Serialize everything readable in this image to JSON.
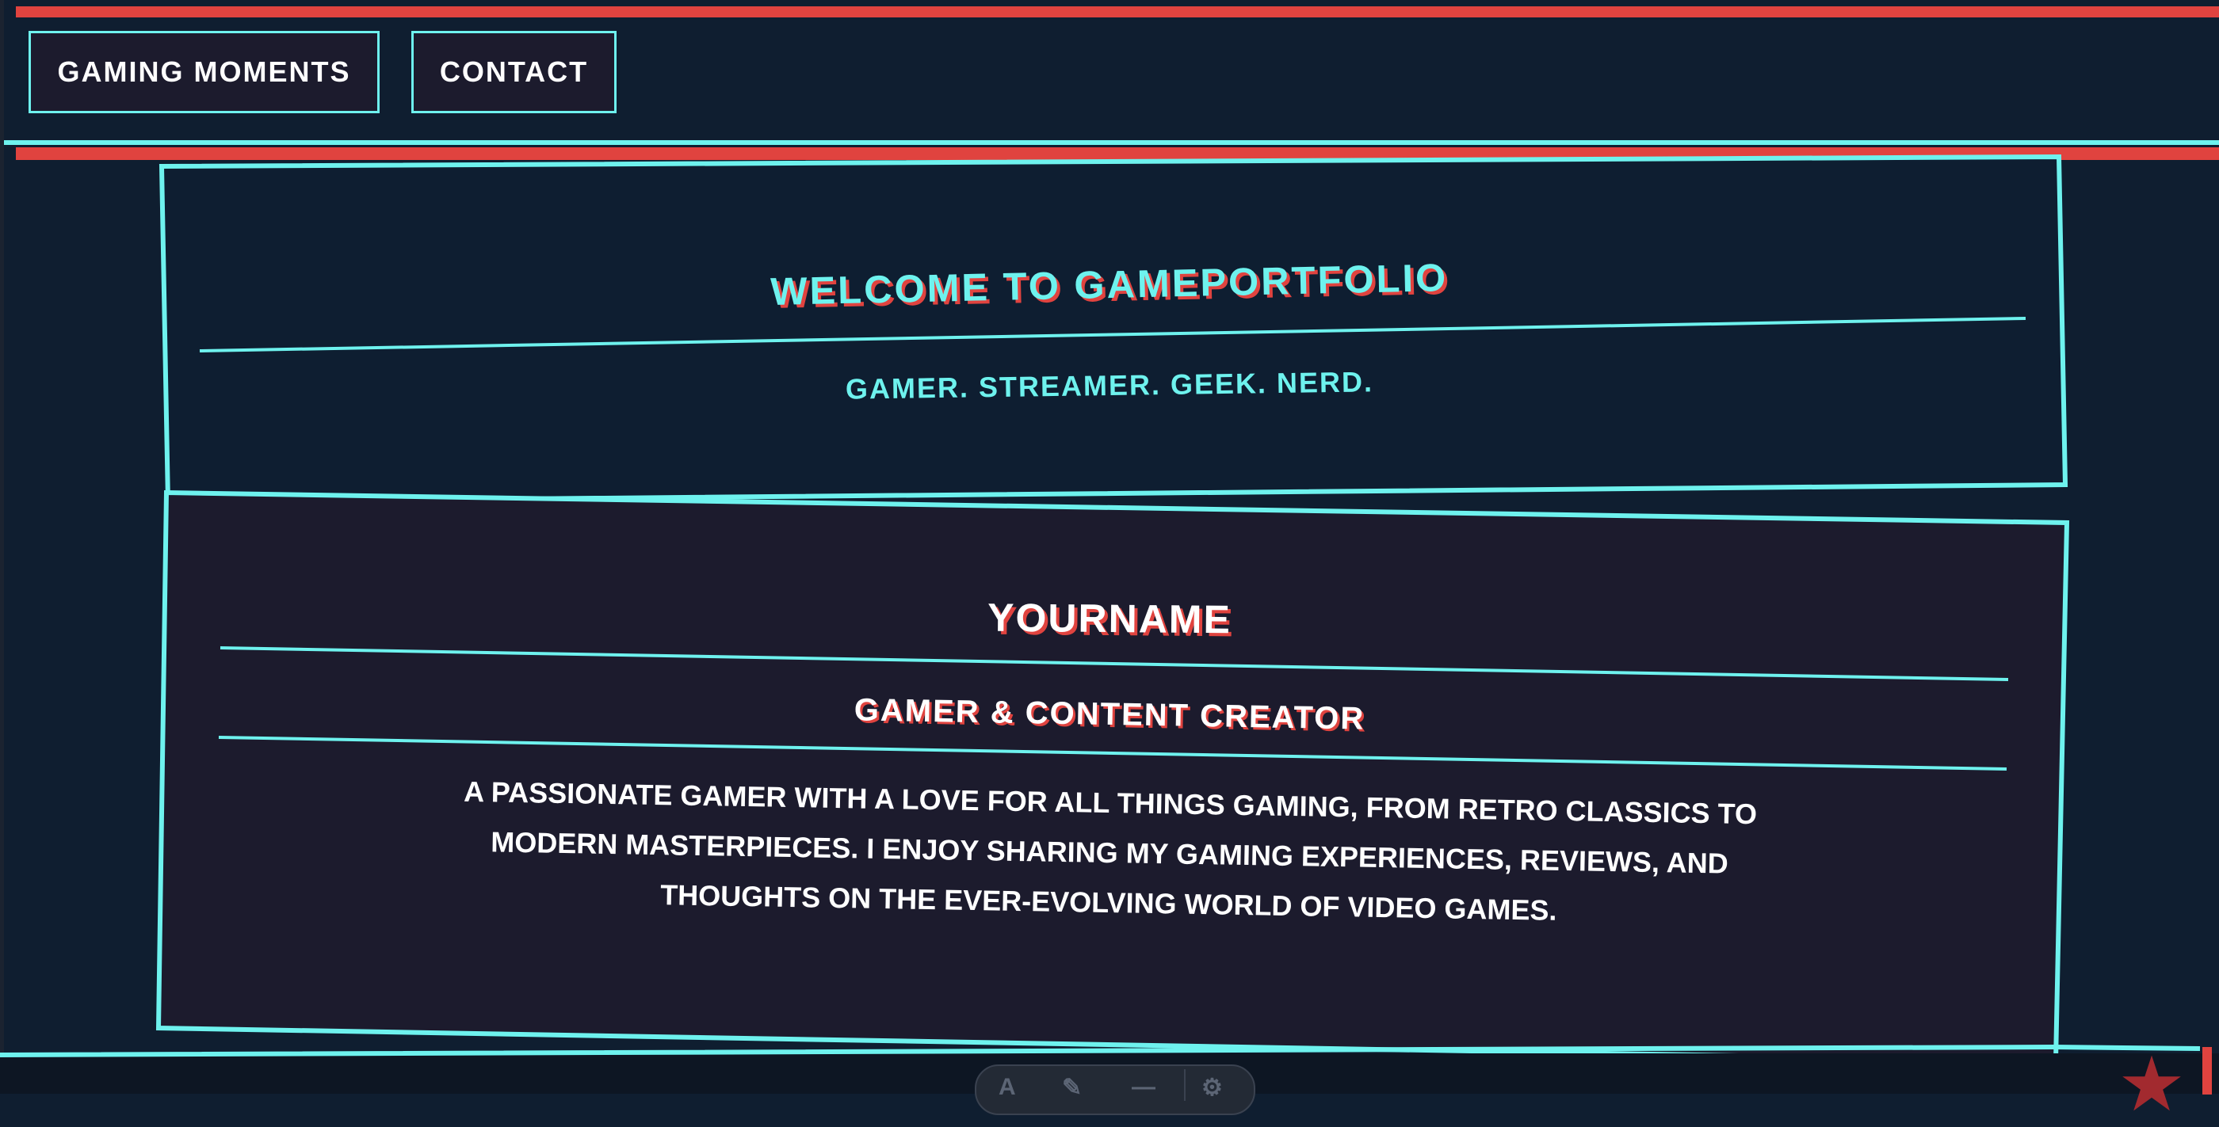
{
  "nav": {
    "items": [
      {
        "label": "GAMING MOMENTS"
      },
      {
        "label": "CONTACT"
      }
    ]
  },
  "hero": {
    "title": "WELCOME TO GAMEPORTFOLIO",
    "subtitle": "GAMER. STREAMER. GEEK. NERD."
  },
  "profile": {
    "name": "YOURNAME",
    "role": "GAMER & CONTENT CREATOR",
    "bio": "A PASSIONATE GAMER WITH A LOVE FOR ALL THINGS GAMING, FROM RETRO CLASSICS TO MODERN MASTERPIECES. I ENJOY SHARING MY GAMING EXPERIENCES, REVIEWS, AND THOUGHTS ON THE EVER-EVOLVING WORLD OF VIDEO GAMES."
  },
  "dock": {
    "icons": [
      "text-tool-icon",
      "brush-icon",
      "minus-icon",
      "settings-icon"
    ]
  },
  "colors": {
    "background": "#0f1e30",
    "card_dark": "#1c1b2d",
    "accent_cyan": "#6ef2ee",
    "accent_red": "#e0433f",
    "text": "#ffffff"
  }
}
